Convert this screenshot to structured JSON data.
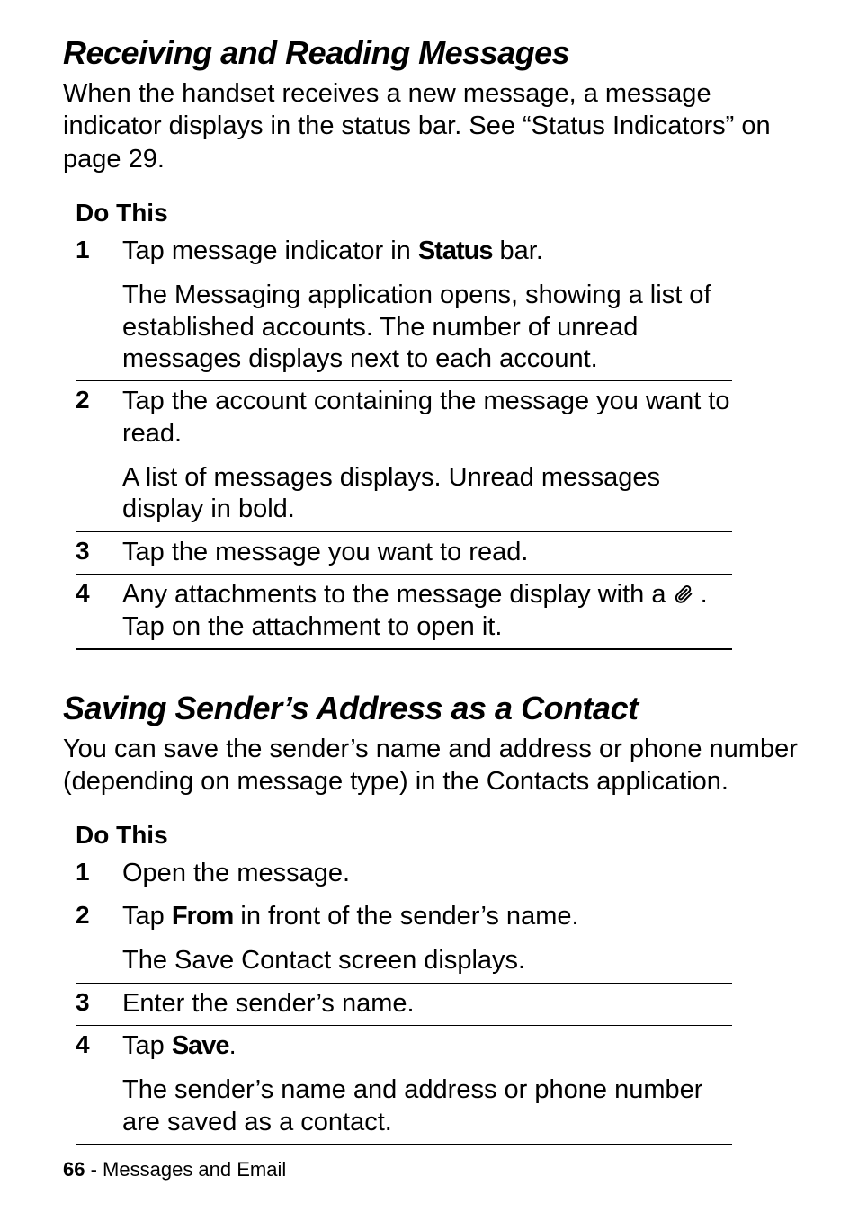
{
  "section1": {
    "title": "Receiving and Reading Messages",
    "body": "When the handset receives a new message, a message indicator displays in the status bar. See “Status Indicators” on page 29.",
    "doThis": "Do This",
    "steps": [
      {
        "num": "1",
        "primary_pre": "Tap message indicator in ",
        "primary_label": "Status",
        "primary_post": " bar.",
        "secondary": "The Messaging application opens, showing a list of established accounts. The number of unread messages displays next to each account."
      },
      {
        "num": "2",
        "primary": "Tap the account containing the message you want to read.",
        "secondary": "A list of messages displays. Unread messages display in bold."
      },
      {
        "num": "3",
        "primary": "Tap the message you want to read."
      },
      {
        "num": "4",
        "primary_pre": "Any attachments to the message display with a ",
        "primary_icon": "paperclip",
        "primary_post": " . Tap on the attachment to open it."
      }
    ]
  },
  "section2": {
    "title": "Saving Sender’s Address as a Contact",
    "body": "You can save the sender’s name and address or phone number (depending on message type) in the Contacts application.",
    "doThis": "Do This",
    "steps": [
      {
        "num": "1",
        "primary": "Open the message."
      },
      {
        "num": "2",
        "primary_pre": "Tap ",
        "primary_label": "From",
        "primary_post": " in front of the sender’s name.",
        "secondary": "The Save Contact screen displays."
      },
      {
        "num": "3",
        "primary": "Enter the sender’s name."
      },
      {
        "num": "4",
        "primary_pre": "Tap ",
        "primary_label": "Save",
        "primary_post": ".",
        "secondary": "The sender’s name and address or phone number are saved as a contact."
      }
    ]
  },
  "footer": {
    "page": "66",
    "sep": " - ",
    "chapter": "Messages and Email"
  }
}
